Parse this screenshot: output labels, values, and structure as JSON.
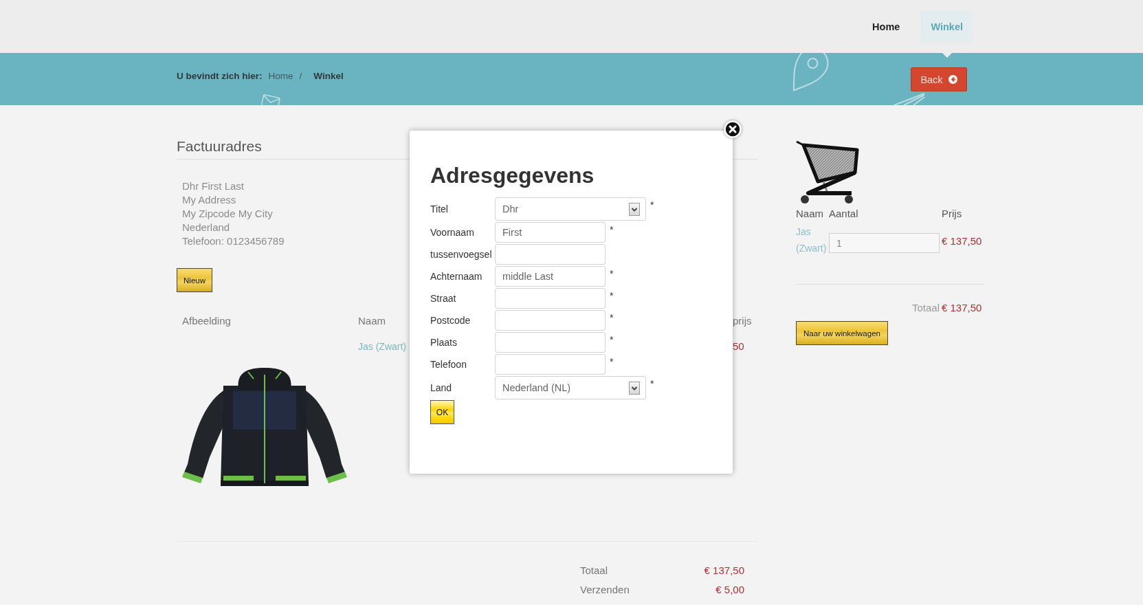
{
  "header": {
    "nav": [
      {
        "label": "Home",
        "selected": false
      },
      {
        "label": "Winkel",
        "selected": true
      }
    ]
  },
  "breadcrumb": {
    "label": "U bevindt zich hier:",
    "separator": "/",
    "items": [
      {
        "label": "Home",
        "current": false
      },
      {
        "label": "Winkel",
        "current": true
      }
    ]
  },
  "back_button": {
    "label": "Back"
  },
  "billing": {
    "title": "Factuuradres",
    "address_lines": [
      "Dhr First Last",
      "My Address",
      "My Zipcode My City",
      "Nederland",
      "Telefoon: 0123456789"
    ],
    "new_button": "Nieuw"
  },
  "order_table": {
    "columns": [
      "Afbeelding",
      "Naam",
      "prijs"
    ],
    "rows": [
      {
        "name": "Jas (Zwart)",
        "price": "50"
      }
    ]
  },
  "order_totals": [
    {
      "label": "Totaal",
      "value": "€ 137,50"
    },
    {
      "label": "Verzenden",
      "value": "€ 5,00"
    }
  ],
  "cart": {
    "columns": [
      "Naam",
      "Aantal",
      "Prijs"
    ],
    "items": [
      {
        "name": "Jas (Zwart)",
        "quantity": "1",
        "price": "€ 137,50"
      }
    ],
    "total_label": "Totaal",
    "total": "€ 137,50",
    "button": "Naar uw winkelwagen"
  },
  "modal": {
    "title": "Adresgegevens",
    "required_mark": "*",
    "fields": [
      {
        "label": "Titel",
        "kind": "select",
        "value": "Dhr",
        "required": true
      },
      {
        "label": "Voornaam",
        "kind": "text",
        "value": "First",
        "required": true
      },
      {
        "label": "tussenvoegsel",
        "kind": "text",
        "required": false
      },
      {
        "label": "Achternaam",
        "kind": "text",
        "value": "middle Last",
        "required": true
      },
      {
        "label": "Straat",
        "kind": "text",
        "required": true
      },
      {
        "label": "Postcode",
        "kind": "text",
        "required": true
      },
      {
        "label": "Plaats",
        "kind": "text",
        "required": true
      },
      {
        "label": "Telefoon",
        "kind": "text",
        "required": true
      },
      {
        "label": "Land",
        "kind": "select",
        "value": "Nederland (NL)",
        "required": true
      }
    ],
    "ok_button": "OK"
  }
}
